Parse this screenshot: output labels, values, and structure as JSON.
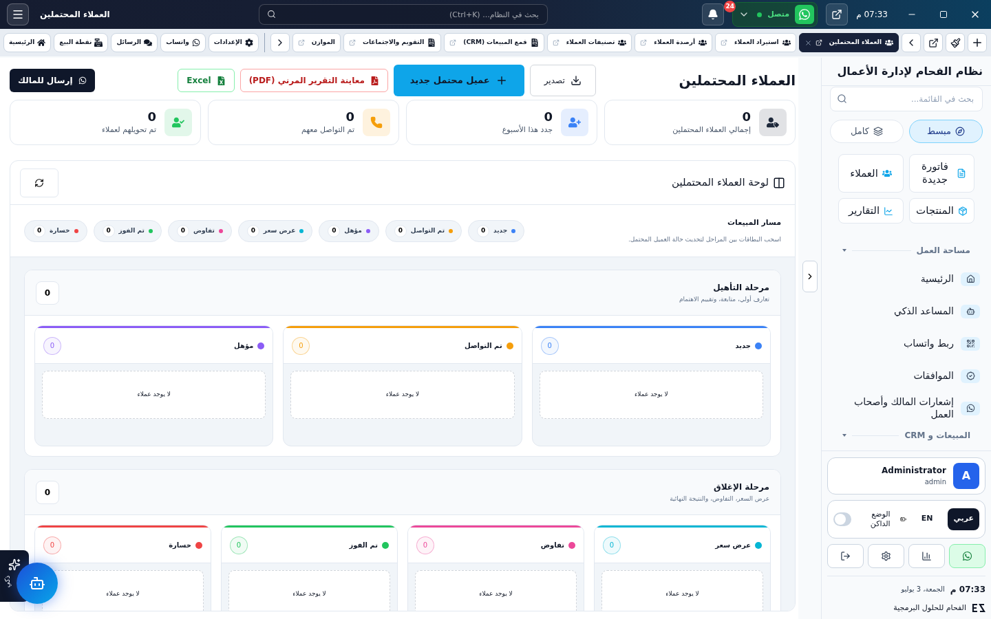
{
  "top_bar": {
    "title": "العملاء المحتملين",
    "search": {
      "placeholder": "بحث في النظام... (Ctrl+K)"
    },
    "notifications_badge": "24",
    "whatsapp": {
      "label": "متصل",
      "connected": true
    },
    "time": "07:33 م"
  },
  "tab_bar": {
    "tabs": [
      {
        "label": "العملاء المحتملين",
        "selected": true
      },
      {
        "label": "استيراد العملاء",
        "selected": false
      },
      {
        "label": "أرصدة العملاء",
        "selected": false
      },
      {
        "label": "تصنيفات العملاء",
        "selected": false
      },
      {
        "label": "قمع المبيعات (CRM)",
        "selected": false
      },
      {
        "label": "التقويم والاجتماعات",
        "selected": false
      },
      {
        "label": "الموازن",
        "selected": false
      }
    ],
    "quick_links": [
      "الإعدادات",
      "واتساب",
      "الرسائل",
      "نقطة البيع",
      "الرئيسية"
    ]
  },
  "page": {
    "title": "العملاء المحتملين",
    "actions": [
      {
        "label": "تصدير",
        "kind": "export"
      },
      {
        "label": "عميل محتمل جديد",
        "kind": "primary"
      },
      {
        "label": "معاينة التقرير المرني (PDF)",
        "kind": "pdf"
      },
      {
        "label": "Excel",
        "kind": "excel"
      },
      {
        "label": "إرسال للمالك",
        "kind": "send"
      }
    ],
    "stats": [
      {
        "value": "0",
        "label": "إجمالي العملاء المحتملين",
        "color": "#1e293b"
      },
      {
        "value": "0",
        "label": "جدد هذا الأسبوع",
        "color": "#3b82f6"
      },
      {
        "value": "0",
        "label": "تم التواصل معهم",
        "color": "#f59e0b"
      },
      {
        "value": "0",
        "label": "تم تحويلهم لعملاء",
        "color": "#22c55e"
      }
    ]
  },
  "board": {
    "title": "لوحة العملاء المحتملين",
    "pipeline": {
      "title": "مسار المبيعات",
      "hint": "اسحب البطاقات بين المراحل لتحديث حالة العميل المحتمل.",
      "stages": [
        {
          "label": "جديد",
          "count": "0",
          "color": "#3b82f6"
        },
        {
          "label": "تم التواصل",
          "count": "0",
          "color": "#f59e0b"
        },
        {
          "label": "مؤهل",
          "count": "0",
          "color": "#8b5cf6"
        },
        {
          "label": "عرض سعر",
          "count": "0",
          "color": "#06b6d4"
        },
        {
          "label": "تفاوض",
          "count": "0",
          "color": "#ec4899"
        },
        {
          "label": "تم الفوز",
          "count": "0",
          "color": "#22c55e"
        },
        {
          "label": "خسارة",
          "count": "0",
          "color": "#ef4444"
        }
      ]
    },
    "groups": [
      {
        "title": "مرحلة التأهيل",
        "subtitle": "تعارف أولي، متابعة، وتقييم الاهتمام",
        "count": "0",
        "columns": [
          {
            "label": "جديد",
            "count": "0",
            "color": "#3b82f6",
            "empty": "لا يوجد عملاء"
          },
          {
            "label": "تم التواصل",
            "count": "0",
            "color": "#f59e0b",
            "empty": "لا يوجد عملاء"
          },
          {
            "label": "مؤهل",
            "count": "0",
            "color": "#8b5cf6",
            "empty": "لا يوجد عملاء"
          }
        ]
      },
      {
        "title": "مرحلة الإغلاق",
        "subtitle": "عرض السعر، التفاوض، والنتيجة النهائية",
        "count": "0",
        "columns": [
          {
            "label": "عرض سعر",
            "count": "0",
            "color": "#06b6d4",
            "empty": "لا يوجد عملاء"
          },
          {
            "label": "تفاوض",
            "count": "0",
            "color": "#ec4899",
            "empty": "لا يوجد عملاء"
          },
          {
            "label": "تم الفوز",
            "count": "0",
            "color": "#22c55e",
            "empty": "لا يوجد عملاء"
          },
          {
            "label": "خسارة",
            "count": "0",
            "color": "#ef4444",
            "empty": "لا يوجد عملاء"
          }
        ]
      }
    ]
  },
  "ai_button": {
    "label": "ذكي"
  },
  "sidebar": {
    "title": "نظام الفحام لإدارة الأعمال",
    "search": {
      "placeholder": "بحث في القائمة..."
    },
    "modes": [
      {
        "label": "مبسط",
        "selected": true
      },
      {
        "label": "كامل",
        "selected": false
      }
    ],
    "shortcuts": [
      "فاتورة جديدة",
      "العملاء",
      "المنتجات",
      "التقارير"
    ],
    "sections": [
      {
        "title": "مساحة العمل",
        "items": [
          "الرئيسية",
          "المساعد الذكي",
          "ربط واتساب",
          "الموافقات",
          "إشعارات المالك وأصحاب العمل"
        ]
      },
      {
        "title": "المبيعات و CRM"
      }
    ],
    "user": {
      "name": "Administrator",
      "role": "admin",
      "initial": "A"
    },
    "languages": [
      {
        "label": "عربي",
        "selected": true
      },
      {
        "label": "EN",
        "selected": false
      }
    ],
    "dark_mode": {
      "label": "الوضع الداكن",
      "on": false
    },
    "footer_buttons": [
      {
        "selected": true
      },
      {
        "selected": false
      },
      {
        "selected": false
      },
      {
        "selected": false
      }
    ],
    "time": "07:33 م",
    "date": "الجمعة، 3 يوليو",
    "brand": "الفحام للحلول البرمجية"
  }
}
